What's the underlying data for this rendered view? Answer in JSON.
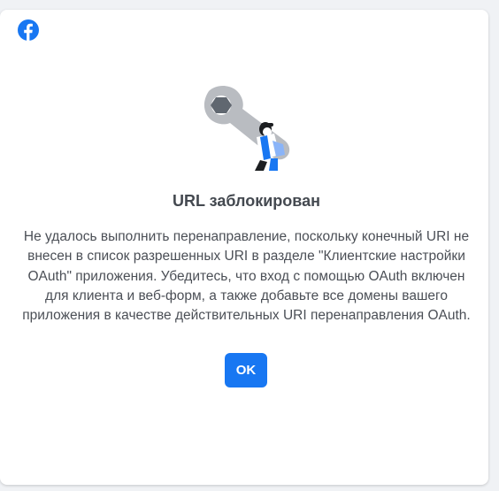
{
  "dialog": {
    "title": "URL заблокирован",
    "message": "Не удалось выполнить перенаправление, поскольку конечный URI не внесен в список разрешенных URI в разделе \"Клиентские настройки OAuth\" приложения. Убедитесь, что вход с помощью OAuth включен для клиента и веб-форм, а также добавьте все домены вашего приложения в качестве действительных URI перенаправления OAuth.",
    "ok_label": "OK"
  },
  "icons": {
    "brand_logo": "facebook-icon",
    "illustration": "wrench-with-person-illustration"
  },
  "colors": {
    "accent": "#1877f2",
    "title_text": "#444950",
    "body_text": "#4b4f56",
    "background": "#f0f2f5",
    "card": "#ffffff"
  }
}
